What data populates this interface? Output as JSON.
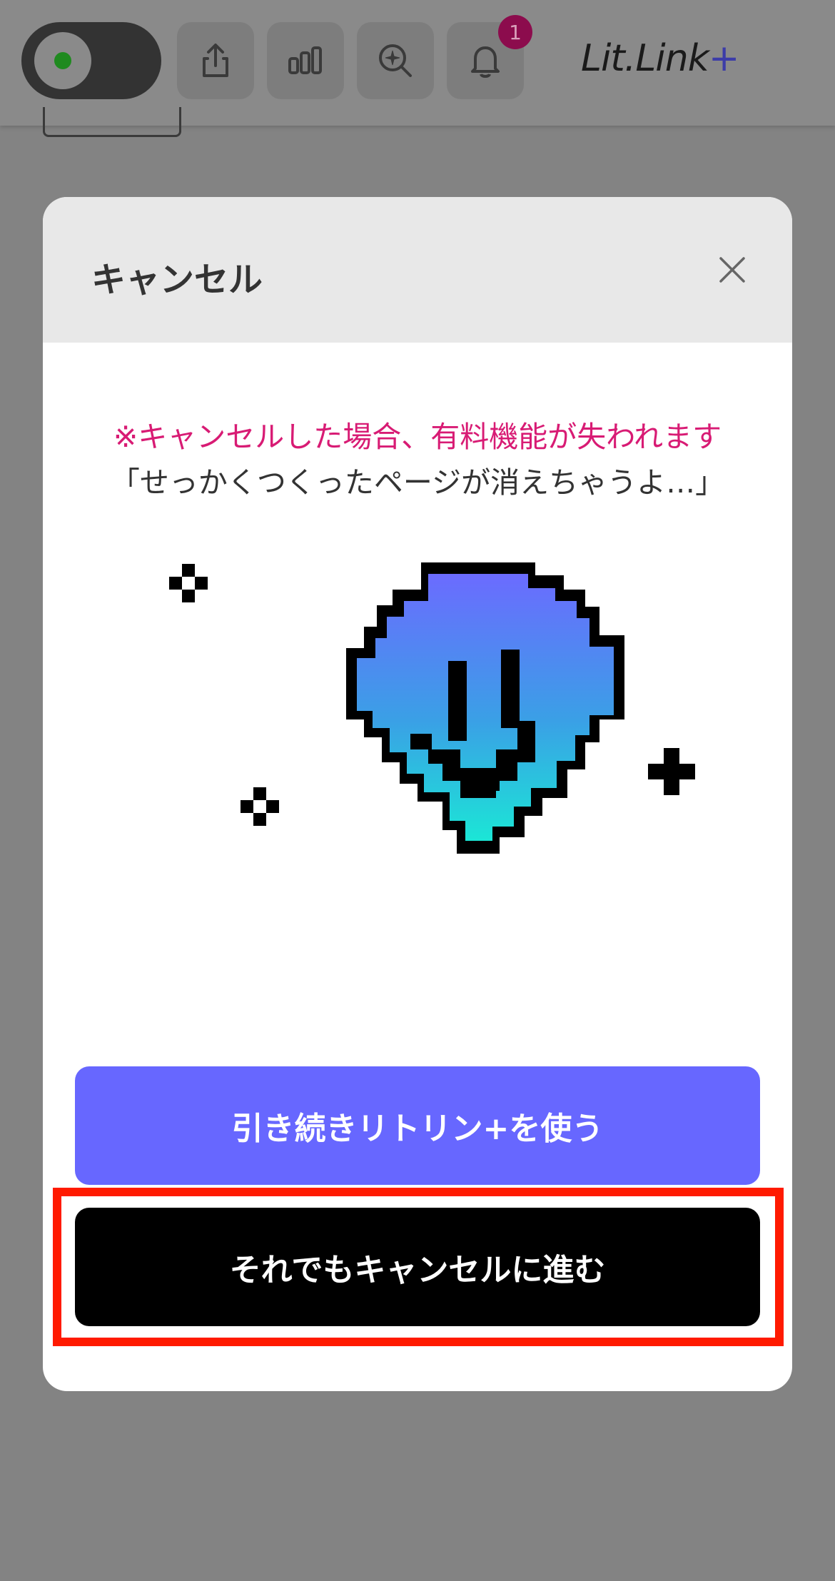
{
  "topbar": {
    "toggle_state": "on",
    "notification_count": "1",
    "logo_text": "Lit.Link",
    "logo_plus": "+",
    "icons": [
      "share-icon",
      "analytics-icon",
      "search-sparkle-icon",
      "bell-icon"
    ]
  },
  "modal": {
    "title": "キャンセル",
    "warning": "※キャンセルした場合、有料機能が失われます",
    "quote": "「せっかくつくったページが消えちゃうよ…」",
    "continue_button": "引き続きリトリン+を使う",
    "cancel_button": "それでもキャンセルに進む"
  },
  "colors": {
    "accent": "#6767ff",
    "warning": "#d81b74",
    "highlight": "#ff1a00",
    "badge": "#8c0c4d"
  }
}
